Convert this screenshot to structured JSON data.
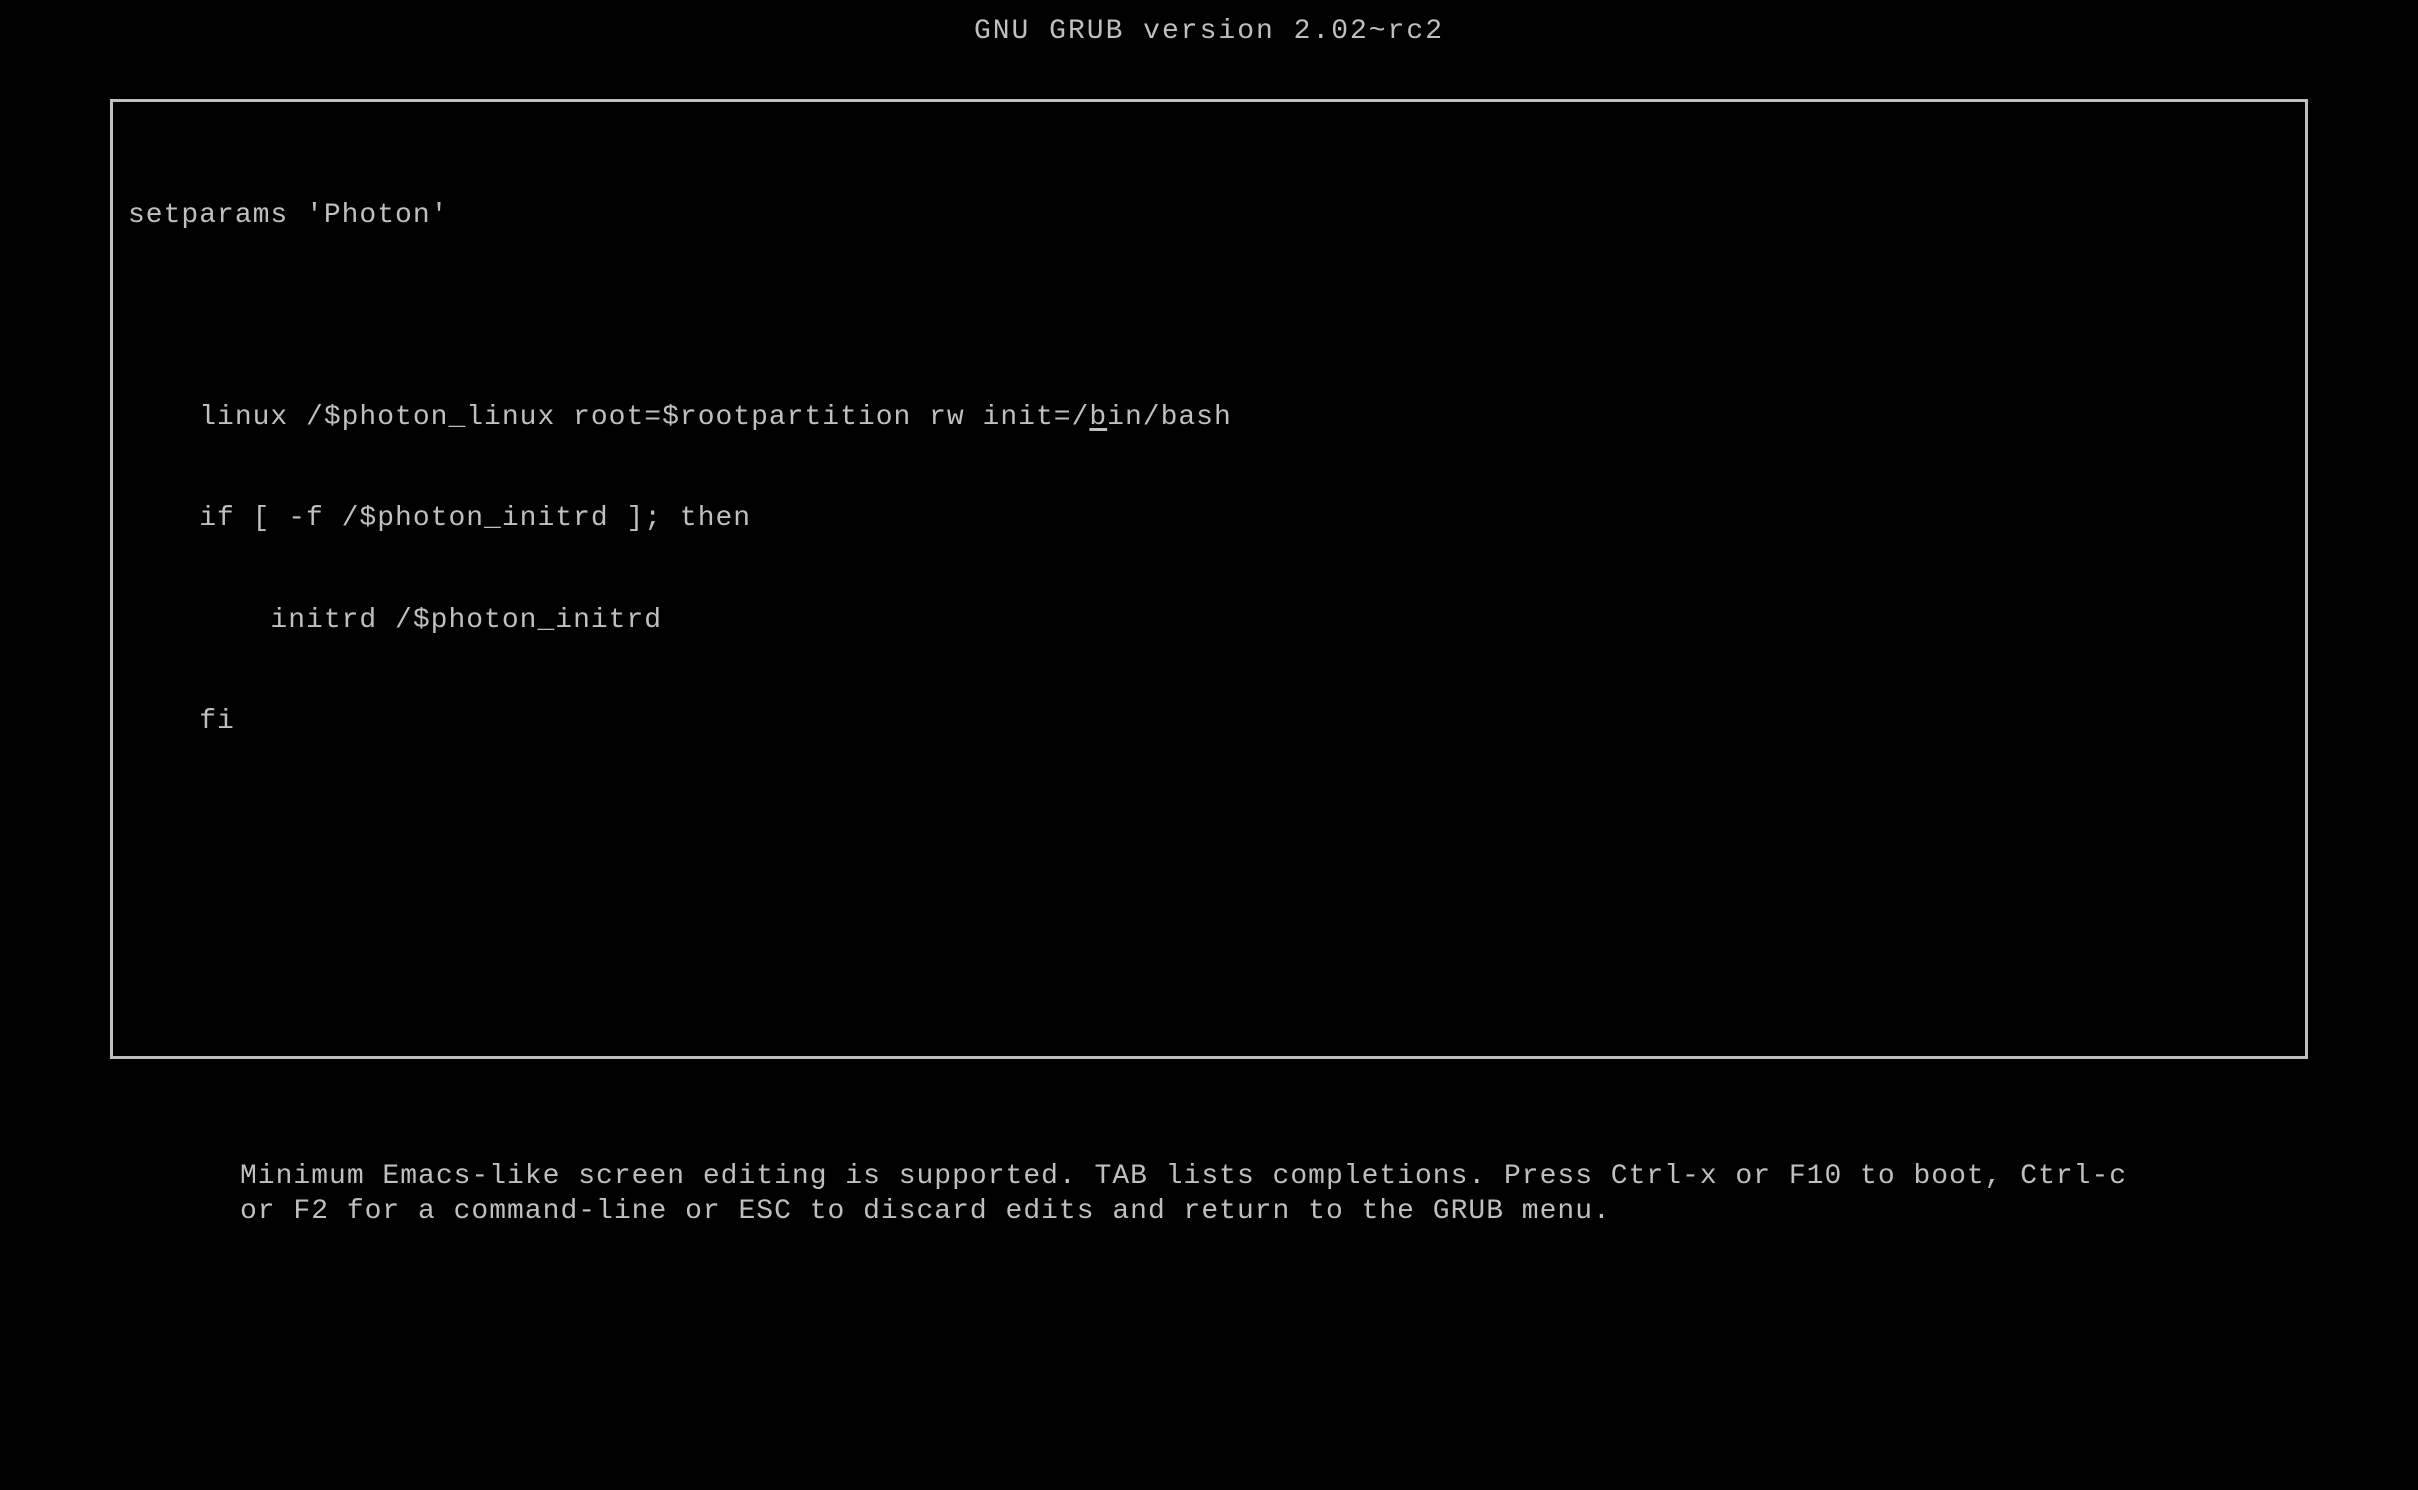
{
  "header": {
    "title": "GNU GRUB  version 2.02~rc2"
  },
  "editor": {
    "lines": {
      "l0": "setparams 'Photon'",
      "l1": "",
      "l2_pre": "    linux /$photon_linux root=$rootpartition rw init=/",
      "l2_cursor": "b",
      "l2_post": "in/bash",
      "l3": "    if [ -f /$photon_initrd ]; then",
      "l4": "        initrd /$photon_initrd",
      "l5": "    fi"
    }
  },
  "help": {
    "text": "Minimum Emacs-like screen editing is supported. TAB lists completions. Press Ctrl-x or F10 to boot, Ctrl-c or F2 for a command-line or ESC to discard edits and return to the GRUB menu."
  }
}
